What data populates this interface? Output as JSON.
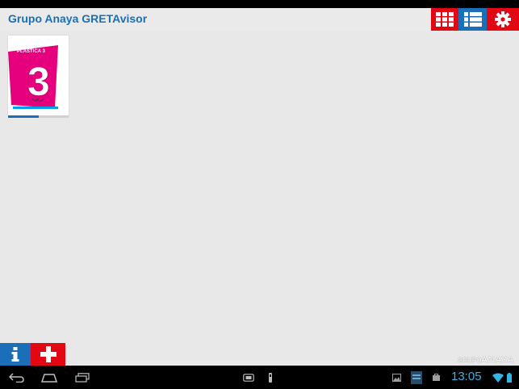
{
  "status_bar_top": {},
  "app_bar": {
    "title": "Grupo Anaya GRETAvisor",
    "toolbar": [
      {
        "id": "grid",
        "icon": "grid-view-icon",
        "color": "#e30613"
      },
      {
        "id": "list",
        "icon": "list-view-icon",
        "color": "#1a6fb8"
      },
      {
        "id": "settings",
        "icon": "gear-icon",
        "color": "#e30613"
      }
    ]
  },
  "library": {
    "books": [
      {
        "cover_title": "PLÁSTICA 3",
        "cover_number": "3",
        "cover_color": "#e6007e",
        "progress": 0.5
      }
    ]
  },
  "footer": {
    "info_icon": "info-icon",
    "add_icon": "plus-icon",
    "info_color": "#1a6fb8",
    "add_color": "#e30613",
    "brand_small": "GRUPO",
    "brand_large": "ANAYA"
  },
  "system_nav": {
    "icons": [
      "back-icon",
      "home-icon",
      "recent-apps-icon",
      "screenshot-icon",
      "usb-icon",
      "gallery-icon",
      "sd-card-icon",
      "shop-icon",
      "wifi-icon",
      "battery-icon"
    ],
    "time": "13:05",
    "accent": "#33b5e5"
  }
}
